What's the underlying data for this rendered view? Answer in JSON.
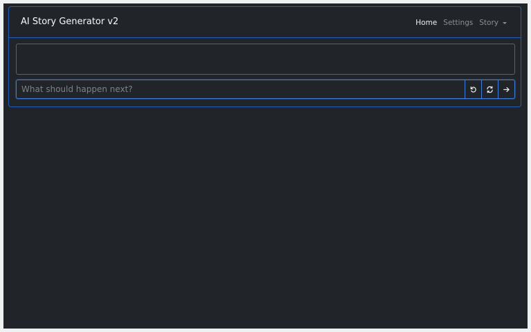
{
  "navbar": {
    "brand": "AI Story Generator v2",
    "links": [
      {
        "label": "Home",
        "active": true
      },
      {
        "label": "Settings",
        "active": false
      },
      {
        "label": "Story",
        "active": false,
        "dropdown": true
      }
    ]
  },
  "story": {
    "text": ""
  },
  "prompt": {
    "placeholder": "What should happen next?",
    "value": ""
  },
  "actions": [
    {
      "icon": "undo-icon"
    },
    {
      "icon": "refresh-icon"
    },
    {
      "icon": "arrow-right-icon"
    }
  ],
  "colors": {
    "background": "#212529",
    "accent": "#1f5fb8",
    "page": "#f0f1f3"
  }
}
